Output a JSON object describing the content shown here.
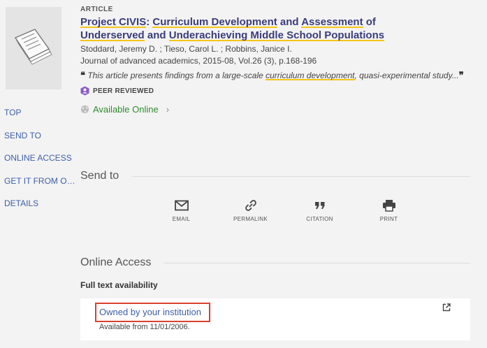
{
  "record": {
    "type": "ARTICLE",
    "title_part1": "Project CIVIS",
    "title_part2": ": ",
    "title_part3": "Curriculum Development",
    "title_part4": " and ",
    "title_part5": "Assessment",
    "title_part6": " of",
    "title_part7": "Underserved",
    "title_part8": " and ",
    "title_part9": "Underachieving Middle School Populations",
    "authors": "Stoddard, Jeremy D. ; Tieso, Carol L. ; Robbins, Janice I.",
    "journal": "Journal of advanced academics, 2015-08, Vol.26 (3), p.168-196",
    "snippet_open_quote": "❝",
    "snippet_before": "This article presents findings from a large-scale ",
    "snippet_highlight": "curriculum development",
    "snippet_after": ", quasi-experimental study...",
    "snippet_close_quote": "❞",
    "peer_reviewed": "PEER REVIEWED",
    "availability": "Available Online"
  },
  "nav": [
    "TOP",
    "SEND TO",
    "ONLINE ACCESS",
    "GET IT FROM OTHER LIBRARIES",
    "DETAILS"
  ],
  "send_to": {
    "heading": "Send to",
    "actions": [
      {
        "label": "EMAIL",
        "icon": "email-icon"
      },
      {
        "label": "PERMALINK",
        "icon": "link-icon"
      },
      {
        "label": "CITATION",
        "icon": "quote-icon"
      },
      {
        "label": "PRINT",
        "icon": "print-icon"
      }
    ]
  },
  "online_access": {
    "heading": "Online Access",
    "full_text_label": "Full text availability",
    "link_text": "Owned by your institution",
    "available_from": "Available from 11/01/2006."
  },
  "colors": {
    "title": "#3a3d7a",
    "highlight_underline": "#f5c518",
    "available_online": "#2f8a2f",
    "link": "#3d5ea8",
    "callout_border": "#d9412e",
    "peer_icon": "#8e5bc9"
  }
}
